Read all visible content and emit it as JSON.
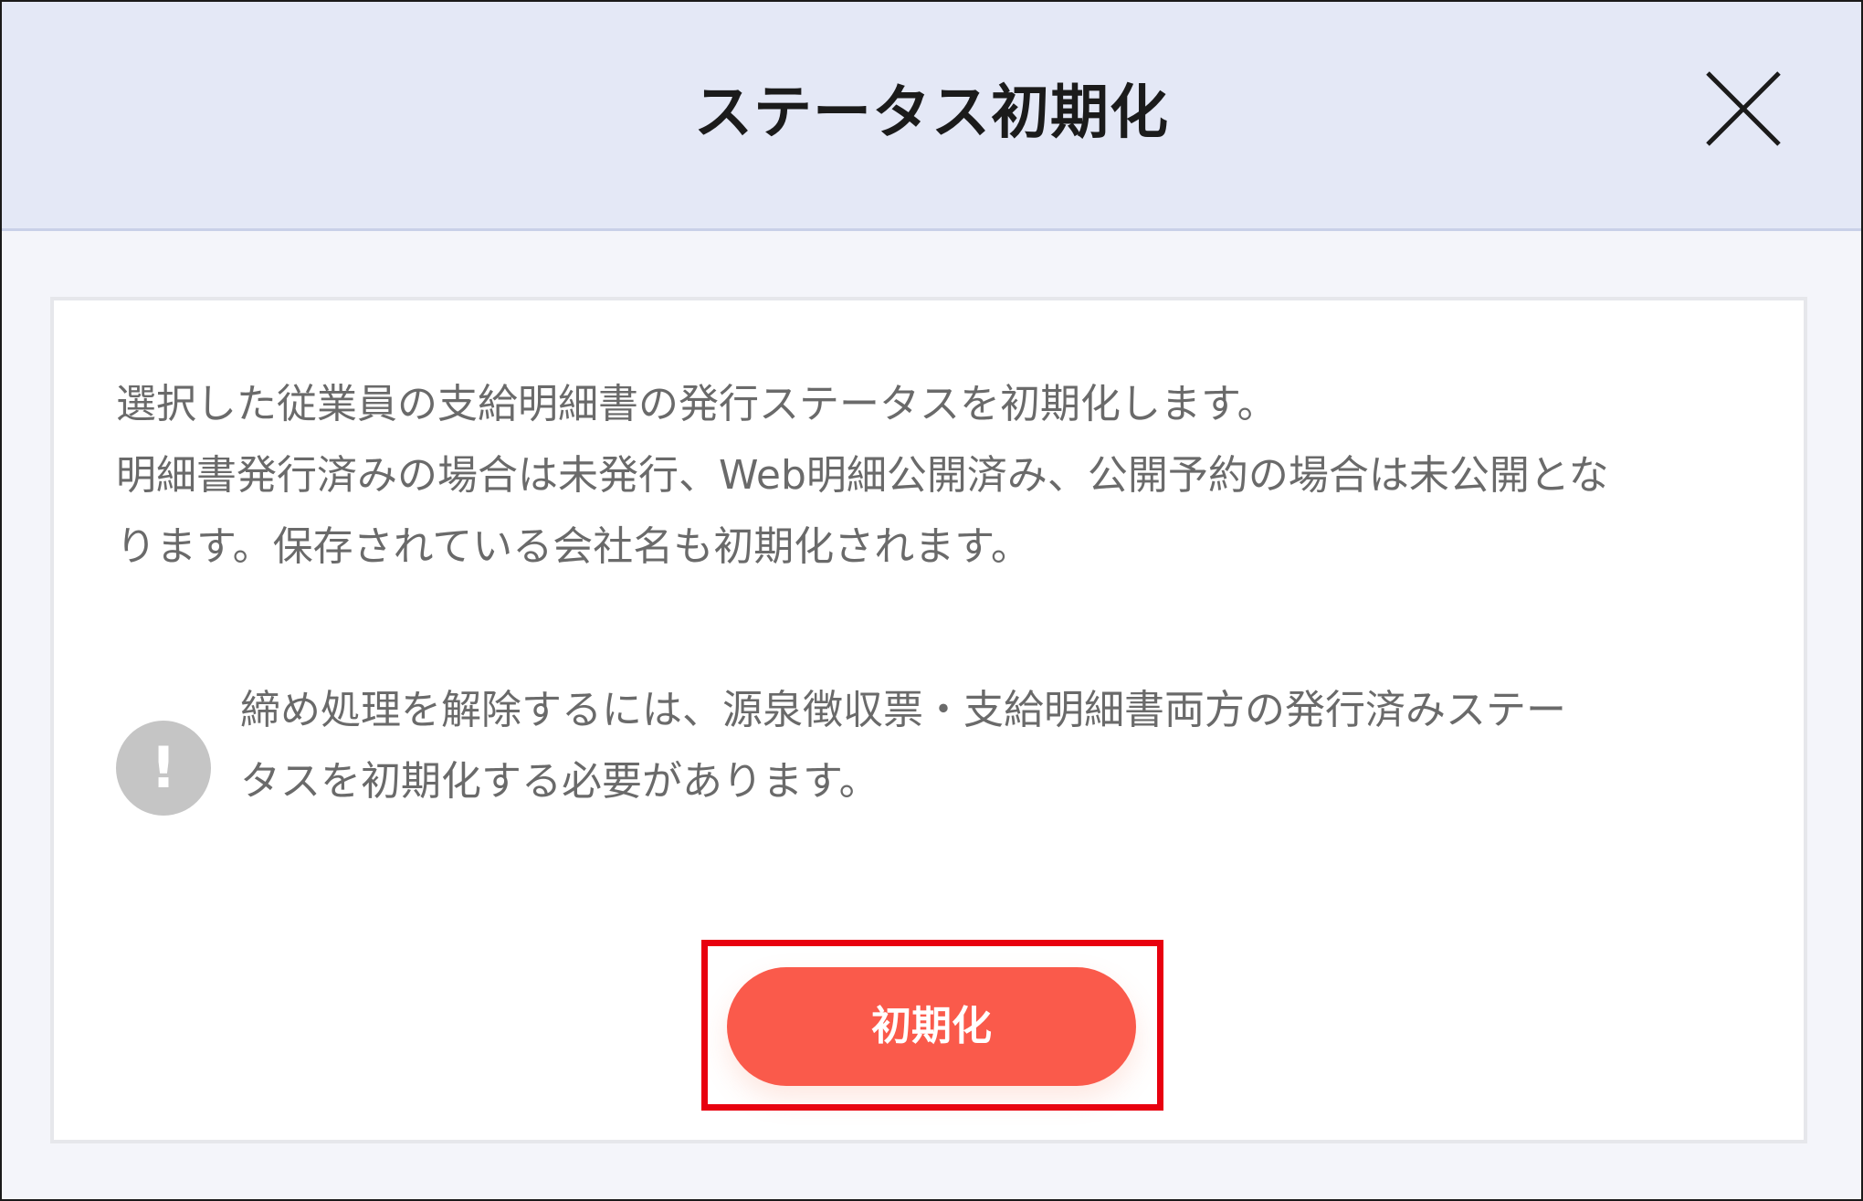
{
  "dialog": {
    "title": "ステータス初期化",
    "close_icon": "close-icon"
  },
  "content": {
    "description_lines": [
      "選択した従業員の支給明細書の発行ステータスを初期化します。",
      "明細書発行済みの場合は未発行、Web明細公開済み、公開予約の場合は未公開とな",
      "ります。保存されている会社名も初期化されます。"
    ],
    "notice": {
      "icon": "exclamation-icon",
      "icon_glyph": "!",
      "lines": [
        "締め処理を解除するには、源泉徴収票・支給明細書両方の発行済みステー",
        "タスを初期化する必要があります。"
      ]
    }
  },
  "actions": {
    "initialize_label": "初期化"
  },
  "colors": {
    "header_bg": "#e4e8f6",
    "primary_button": "#fa5a4b",
    "highlight_frame": "#e8000f",
    "notice_icon": "#c5c5c5"
  }
}
